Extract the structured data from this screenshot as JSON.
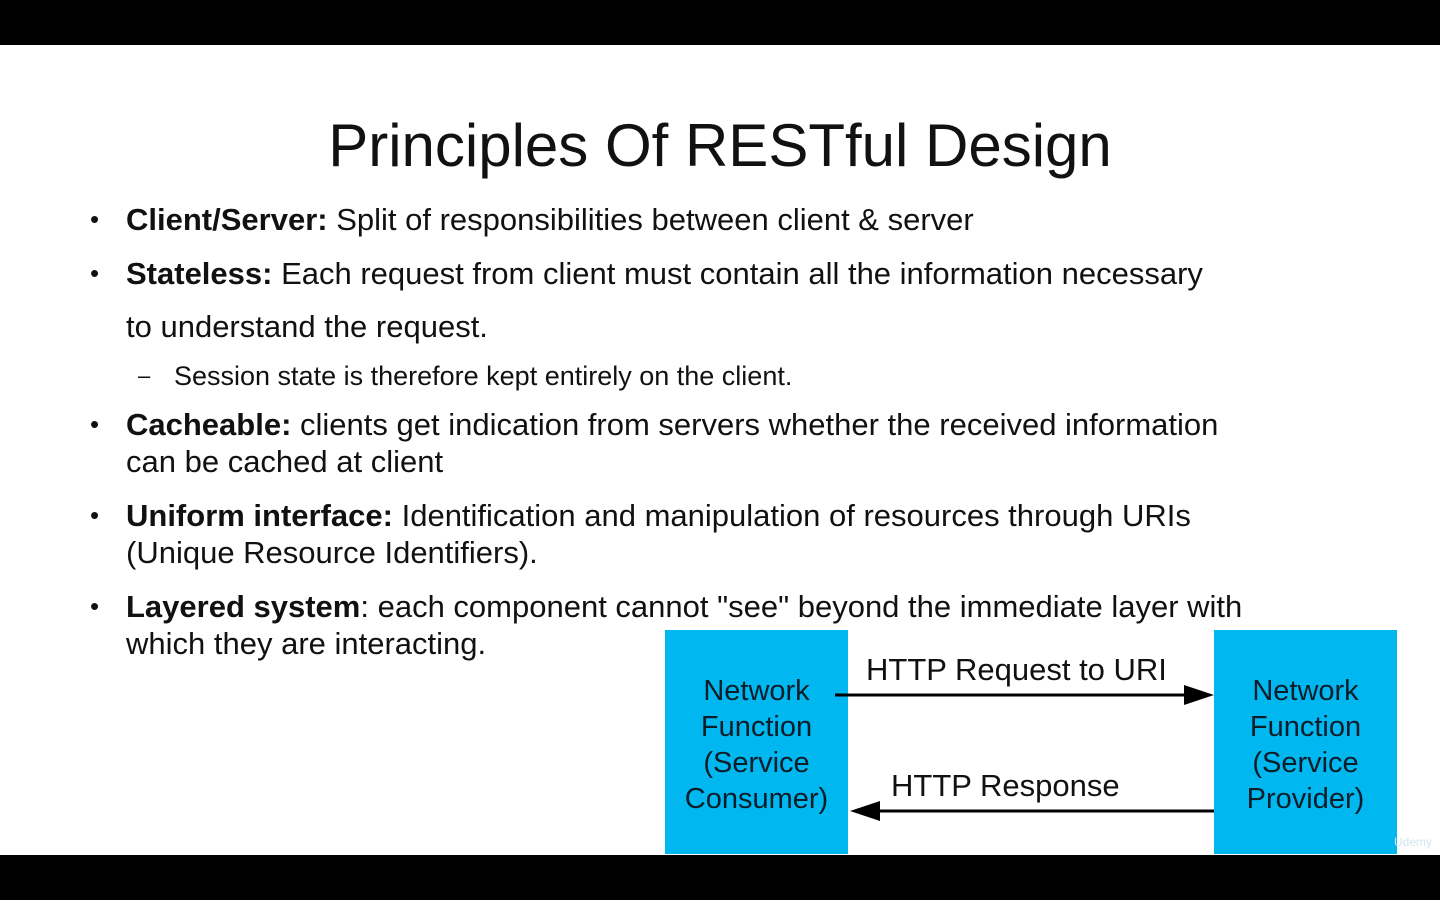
{
  "slide": {
    "title": "Principles Of RESTful Design",
    "bullets": [
      {
        "term": "Client/Server:",
        "text": " Split of responsibilities between client & server"
      },
      {
        "term": "Stateless:",
        "text": " Each request from client must contain all the information necessary"
      },
      {
        "continuation": "to understand the request."
      },
      {
        "sub": "Session state is therefore kept entirely on the client."
      },
      {
        "term": "Cacheable:",
        "text": " clients get indication from servers whether the received information",
        "line2": "can be cached at client"
      },
      {
        "term": "Uniform interface:",
        "text": " Identification and manipulation of resources through URIs",
        "line2": "(Unique Resource Identifiers)."
      },
      {
        "term": "Layered system",
        "text": ": each component cannot \"see\" beyond the immediate layer with",
        "line2": "which they are interacting."
      }
    ],
    "bullet_symbol": "•",
    "dash_symbol": "–"
  },
  "diagram": {
    "consumer": [
      "Network",
      "Function",
      "(Service",
      "Consumer)"
    ],
    "provider": [
      "Network",
      "Function",
      "(Service",
      "Provider)"
    ],
    "request_label": "HTTP Request to URI",
    "response_label": "HTTP Response",
    "box_color": "#00b7ef"
  },
  "watermark": "Udemy"
}
